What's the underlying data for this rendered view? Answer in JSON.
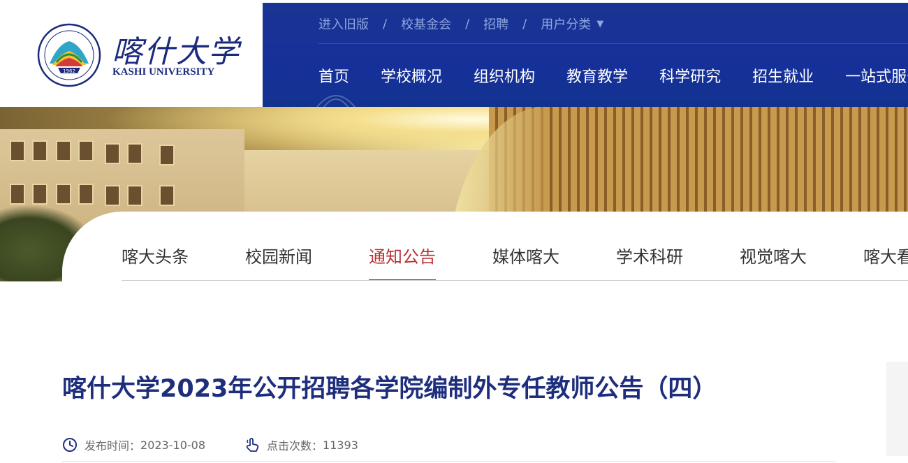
{
  "header": {
    "logo": {
      "cn_name": "喀什大学",
      "en_name": "KASHI UNIVERSITY",
      "seal_year": "1962"
    },
    "top_links": [
      {
        "label": "进入旧版"
      },
      {
        "label": "校基金会"
      },
      {
        "label": "招聘"
      },
      {
        "label": "用户分类",
        "has_dropdown": true
      }
    ],
    "top_link_separator": "/",
    "main_nav": [
      {
        "label": "首页"
      },
      {
        "label": "学校概况"
      },
      {
        "label": "组织机构"
      },
      {
        "label": "教育教学"
      },
      {
        "label": "科学研究"
      },
      {
        "label": "招生就业"
      },
      {
        "label": "一站式服务"
      }
    ],
    "colors": {
      "header_blue": "#16309a",
      "top_link": "#8ea6de"
    }
  },
  "sub_nav": {
    "items": [
      {
        "label": "喀大头条"
      },
      {
        "label": "校园新闻"
      },
      {
        "label": "通知公告",
        "active": true
      },
      {
        "label": "媒体喀大"
      },
      {
        "label": "学术科研"
      },
      {
        "label": "视觉喀大"
      },
      {
        "label": "喀大看点"
      }
    ],
    "active_color": "#b92e33"
  },
  "article": {
    "title": "喀什大学2023年公开招聘各学院编制外专任教师公告（四）",
    "publish_label": "发布时间：",
    "publish_date": "2023-10-08",
    "views_label": "点击次数：",
    "views": "11393",
    "title_color": "#1e2e7d"
  },
  "icons": {
    "clock": "clock-icon",
    "click": "pointer-hand-icon",
    "dropdown": "caret-down-icon"
  }
}
